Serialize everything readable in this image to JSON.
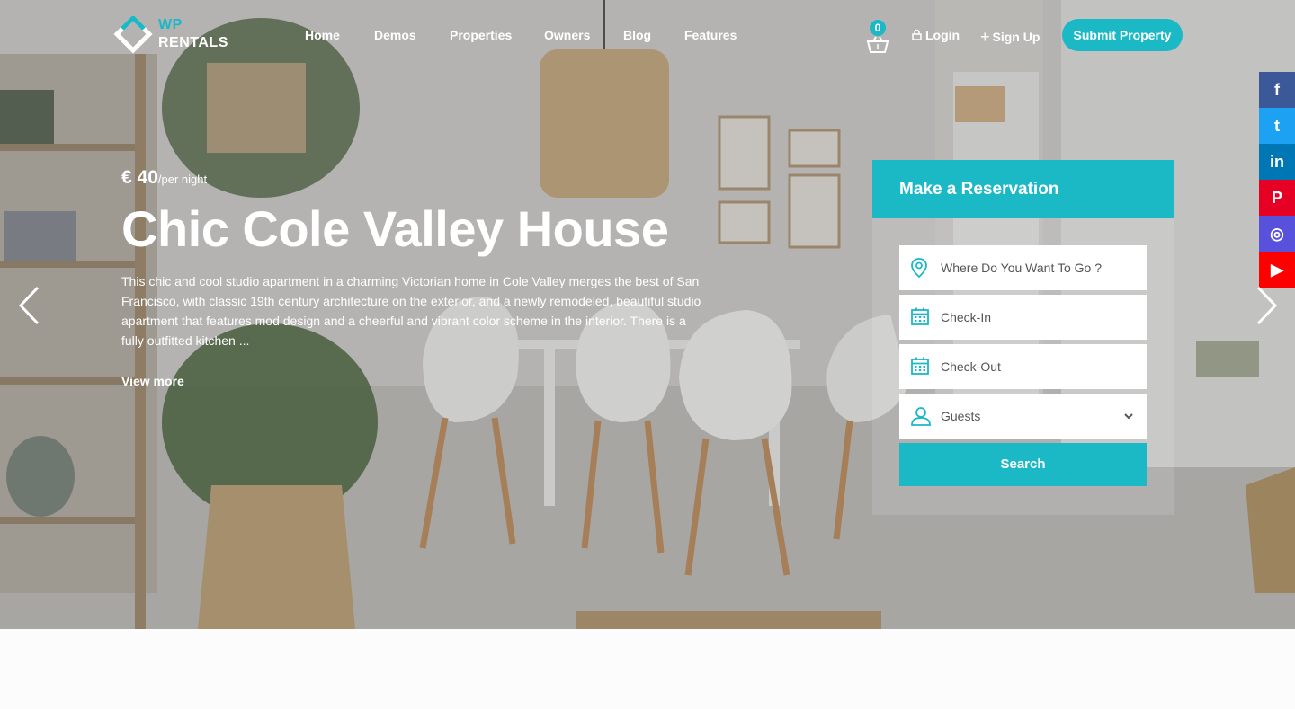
{
  "brand": {
    "line1": "WP",
    "line2": "RENTALS",
    "accent": "#1bb8c6"
  },
  "nav": {
    "items": [
      "Home",
      "Demos",
      "Properties",
      "Owners",
      "Blog",
      "Features"
    ]
  },
  "header": {
    "cart_count": "0",
    "login_label": "Login",
    "signup_label": "Sign Up",
    "submit_label": "Submit Property"
  },
  "social": [
    {
      "icon": "facebook-icon",
      "glyph": "f",
      "color": "#3b5998"
    },
    {
      "icon": "twitter-icon",
      "glyph": "t",
      "color": "#1da1f2"
    },
    {
      "icon": "linkedin-icon",
      "glyph": "in",
      "color": "#0077b5"
    },
    {
      "icon": "pinterest-icon",
      "glyph": "P",
      "color": "#e60023"
    },
    {
      "icon": "instagram-icon",
      "glyph": "◎",
      "color": "#5851db"
    },
    {
      "icon": "youtube-icon",
      "glyph": "▶",
      "color": "#ff0000"
    }
  ],
  "hero": {
    "price": "€ 40",
    "price_unit": "/per night",
    "title": "Chic Cole Valley House",
    "description": "This chic and cool studio apartment in a charming Victorian home in Cole Valley merges the best of San Francisco, with classic 19th century architecture on the exterior, and a newly remodeled, beautiful studio apartment that features mod design and a cheerful and vibrant color scheme in the interior. There is a fully outfitted kitchen ...",
    "view_more": "View more"
  },
  "reservation": {
    "heading": "Make a Reservation",
    "location_placeholder": "Where Do You Want To Go ?",
    "checkin_placeholder": "Check-In",
    "checkout_placeholder": "Check-Out",
    "guests_label": "Guests",
    "search_label": "Search"
  }
}
